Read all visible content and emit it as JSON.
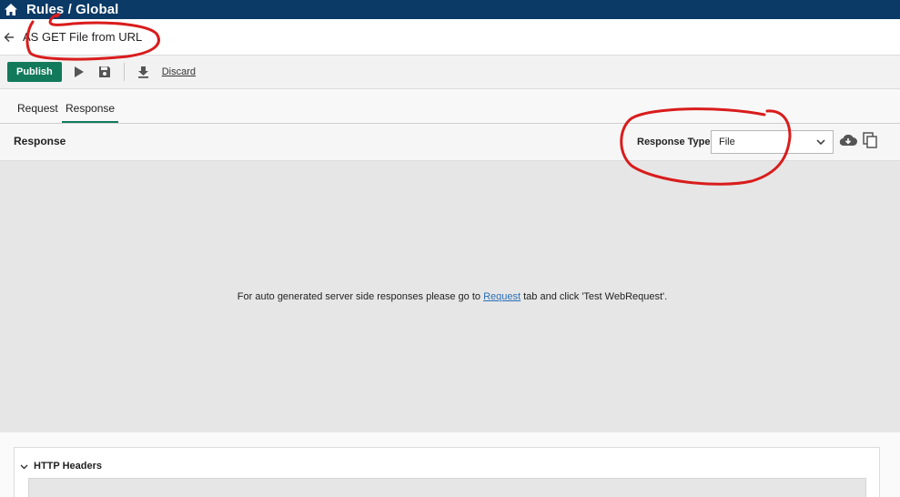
{
  "header": {
    "title": "Rules / Global",
    "home_icon": "home-icon"
  },
  "rule": {
    "title": "AS GET File from URL",
    "back_icon": "arrow-left-icon"
  },
  "toolbar": {
    "publish_label": "Publish",
    "run_icon": "play-icon",
    "save_icon": "save-icon",
    "download_icon": "download-icon",
    "discard_label": "Discard"
  },
  "tabs": [
    {
      "label": "Request",
      "active": false
    },
    {
      "label": "Response",
      "active": true
    }
  ],
  "response": {
    "section_label": "Response",
    "type_label": "Response Type",
    "type_value": "File",
    "message_before": "For auto generated server side responses please go to ",
    "message_link": "Request",
    "message_after": " tab and click 'Test WebRequest'."
  },
  "http_headers": {
    "title": "HTTP Headers"
  },
  "colors": {
    "topbar": "#0b3a66",
    "accent": "#127a5b",
    "link": "#2a6fb8",
    "annotation": "#d91c1c"
  }
}
